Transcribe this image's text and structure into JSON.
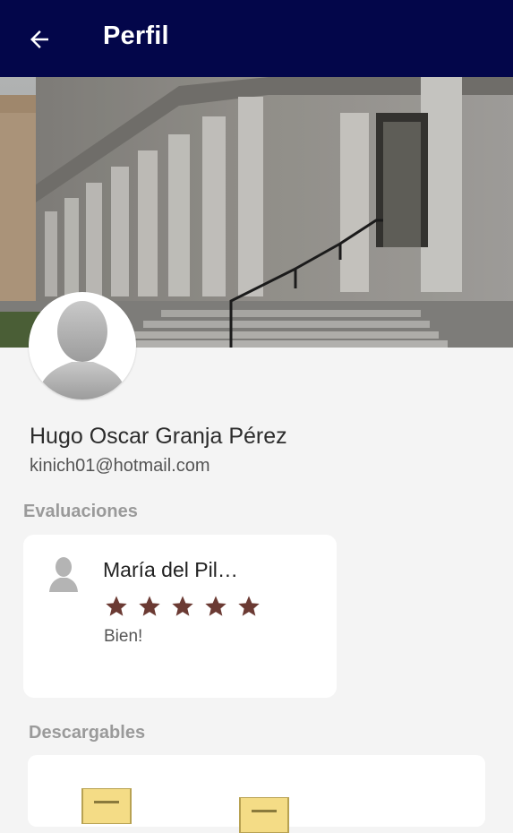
{
  "header": {
    "title": "Perfil",
    "back_icon": "arrow-left-icon"
  },
  "profile": {
    "name": "Hugo Oscar Granja Pérez",
    "email": "kinich01@hotmail.com",
    "avatar_icon": "person-silhouette-icon"
  },
  "evaluations": {
    "title": "Evaluaciones",
    "items": [
      {
        "reviewer": "María del Pil…",
        "rating": 5,
        "comment": "Bien!"
      }
    ]
  },
  "downloads": {
    "title": "Descargables"
  },
  "colors": {
    "appbar": "#03064a",
    "star": "#6b3a33",
    "background": "#f4f4f4"
  }
}
